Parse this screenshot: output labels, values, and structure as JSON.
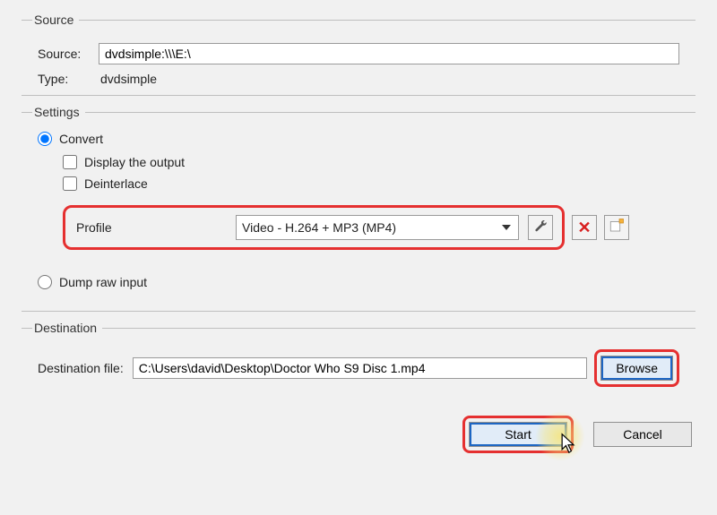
{
  "source": {
    "legend": "Source",
    "label_source": "Source:",
    "value": "dvdsimple:\\\\\\E:\\",
    "label_type": "Type:",
    "type_value": "dvdsimple"
  },
  "settings": {
    "legend": "Settings",
    "convert": {
      "label": "Convert",
      "selected": true,
      "display_output": {
        "label": "Display the output",
        "checked": false
      },
      "deinterlace": {
        "label": "Deinterlace",
        "checked": false
      },
      "profile_label": "Profile",
      "profile_selected": "Video - H.264 + MP3 (MP4)"
    },
    "dump": {
      "label": "Dump raw input",
      "selected": false
    }
  },
  "destination": {
    "legend": "Destination",
    "label": "Destination file:",
    "value": "C:\\Users\\david\\Desktop\\Doctor Who S9 Disc 1.mp4",
    "browse": "Browse"
  },
  "footer": {
    "start": "Start",
    "cancel": "Cancel"
  }
}
